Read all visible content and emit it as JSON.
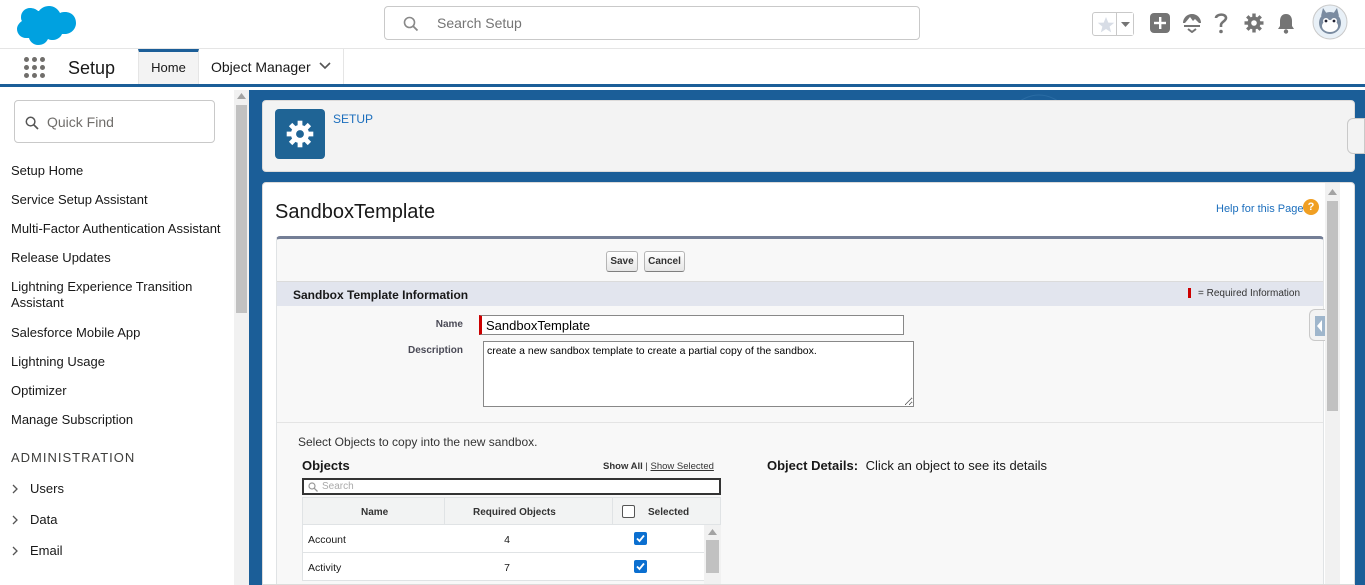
{
  "header": {
    "search_placeholder": "Search Setup",
    "logo": "salesforce-cloud-logo",
    "icons": [
      "favorites-star-icon",
      "favorites-caret-icon",
      "global-add-icon",
      "trailhead-icon",
      "help-icon",
      "setup-gear-icon",
      "notifications-bell-icon",
      "user-avatar"
    ]
  },
  "context_bar": {
    "app_name": "Setup",
    "tabs": [
      {
        "label": "Home",
        "active": true
      },
      {
        "label": "Object Manager",
        "active": false
      }
    ]
  },
  "sidebar": {
    "quick_find_placeholder": "Quick Find",
    "items": [
      "Setup Home",
      "Service Setup Assistant",
      "Multi-Factor Authentication Assistant",
      "Release Updates",
      "Lightning Experience Transition Assistant",
      "Salesforce Mobile App",
      "Lightning Usage",
      "Optimizer",
      "Manage Subscription"
    ],
    "section_title": "ADMINISTRATION",
    "expandable": [
      "Users",
      "Data",
      "Email"
    ]
  },
  "setup_header": {
    "label": "SETUP"
  },
  "page": {
    "title": "SandboxTemplate",
    "help_link": "Help for this Page",
    "help_glyph": "?"
  },
  "form": {
    "save_label": "Save",
    "cancel_label": "Cancel",
    "section_title": "Sandbox Template Information",
    "required_text": "= Required Information",
    "name_label": "Name",
    "name_value": "SandboxTemplate",
    "description_label": "Description",
    "description_value": "create a new sandbox template to create a partial copy of the sandbox.",
    "select_instruction": "Select Objects to copy into the new sandbox.",
    "objects_title": "Objects",
    "show_all": "Show All",
    "show_sep": "|",
    "show_selected": "Show Selected",
    "object_search_placeholder": "Search",
    "columns": [
      "Name",
      "Required Objects",
      "Selected"
    ],
    "rows": [
      {
        "name": "Account",
        "required": "4",
        "selected": true
      },
      {
        "name": "Activity",
        "required": "7",
        "selected": true
      }
    ],
    "details_title": "Object Details:",
    "details_text": "Click an object to see its details"
  },
  "colors": {
    "brand_blue": "#1b5e98",
    "link": "#1b6ebd",
    "checkbox": "#0b6fd0",
    "required": "#cc0000",
    "help_badge": "#f09f23"
  }
}
